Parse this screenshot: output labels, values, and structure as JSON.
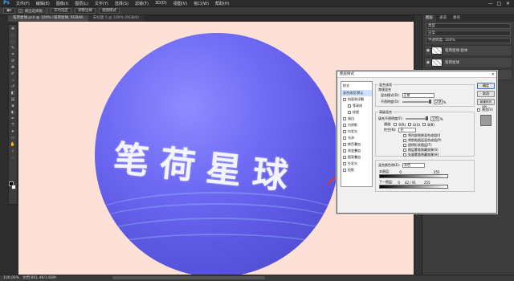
{
  "app": {
    "logo": "Ps"
  },
  "menu": [
    "文件(F)",
    "编辑(E)",
    "图像(I)",
    "图层(L)",
    "文字(Y)",
    "选择(S)",
    "滤镜(T)",
    "3D(D)",
    "视图(V)",
    "窗口(W)",
    "帮助(H)"
  ],
  "window_controls": [
    "—",
    "□",
    "✕"
  ],
  "options": {
    "preset": "调出选择板",
    "mode1": "实时选区",
    "mode2": "调整边缘",
    "mode3": "视图模式"
  },
  "doc_tab": {
    "title": "笔荷星球.psd @ 100% (笔荷星球, RGB/8)",
    "title2": "未标题-1 @ 100% (RGB/8)"
  },
  "canvas_text": "笔荷星球",
  "status": {
    "zoom": "100.00%",
    "doc": "文档:861.4K/3.68M"
  },
  "panels": {
    "tabs": [
      "图层",
      "通道",
      "路径"
    ],
    "layers": [
      {
        "name": "笔荷星球 副本"
      },
      {
        "name": "笔荷星球"
      },
      {
        "name": "背景"
      }
    ],
    "kind": "类型",
    "blend": "正常",
    "opacity": "不透明度: 100%"
  },
  "dialog": {
    "title": "图层样式",
    "styles_header": "样式",
    "styles": [
      {
        "label": "混合选项:默认",
        "selected": true,
        "sub": false
      },
      {
        "label": "斜面和浮雕",
        "sub": false
      },
      {
        "label": "等高线",
        "sub": true
      },
      {
        "label": "纹理",
        "sub": true
      },
      {
        "label": "描边",
        "sub": false
      },
      {
        "label": "内阴影",
        "sub": false
      },
      {
        "label": "内发光",
        "sub": false
      },
      {
        "label": "光泽",
        "sub": false
      },
      {
        "label": "颜色叠加",
        "sub": false
      },
      {
        "label": "渐变叠加",
        "sub": false
      },
      {
        "label": "图案叠加",
        "sub": false
      },
      {
        "label": "外发光",
        "sub": false
      },
      {
        "label": "投影",
        "sub": false
      }
    ],
    "general": {
      "title": "混合选项",
      "sub": "常规混合",
      "blend_label": "混合模式(D):",
      "blend_value": "正常",
      "opacity_label": "不透明度(O):",
      "opacity_value": "100",
      "pct": "%"
    },
    "advanced": {
      "title": "高级混合",
      "fill_label": "填充不透明度(F):",
      "fill_value": "100",
      "pct": "%",
      "channels_label": "通道:",
      "r": "R(R)",
      "g": "G(G)",
      "b": "B(B)",
      "knockout_label": "挖空(N):",
      "knockout_value": "无",
      "checks": [
        "将内部效果混合成组(I)",
        "将剪贴图层混合成组(P)",
        "透明形状图层(T)",
        "图层蒙版隐藏效果(S)",
        "矢量蒙版隐藏效果(H)"
      ]
    },
    "blend_if": {
      "title": "混合颜色带(E):",
      "value": "灰色",
      "this_layer": "本图层:",
      "this_min": "0",
      "this_max": "255",
      "under_layer": "下一图层:",
      "under_min": "0",
      "under_vals": "42 / 91",
      "under_max": "255"
    },
    "buttons": {
      "ok": "确定",
      "cancel": "取消",
      "new_style": "新建样式(W)...",
      "preview": "预览(V)"
    }
  }
}
